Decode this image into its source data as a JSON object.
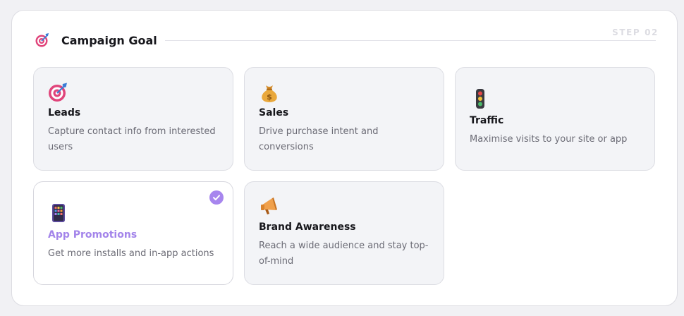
{
  "header": {
    "title": "Campaign Goal",
    "step": "STEP 02",
    "icon": "target-icon"
  },
  "goals": [
    {
      "name": "Leads",
      "description": "Capture contact info from interested users",
      "icon": "target-icon",
      "selected": false
    },
    {
      "name": "Sales",
      "description": "Drive purchase intent and conversions",
      "icon": "money-bag-icon",
      "selected": false
    },
    {
      "name": "Traffic",
      "description": "Maximise visits to your site or app",
      "icon": "traffic-light-icon",
      "selected": false
    },
    {
      "name": "App Promotions",
      "description": "Get more installs and in-app actions",
      "icon": "app-icon",
      "selected": true
    },
    {
      "name": "Brand Awareness",
      "description": "Reach a wide audience and stay top-of-mind",
      "icon": "megaphone-icon",
      "selected": false
    }
  ],
  "colors": {
    "accent": "#a786ee",
    "selected_title": "#a384ea",
    "card_bg": "#f3f4f7"
  }
}
